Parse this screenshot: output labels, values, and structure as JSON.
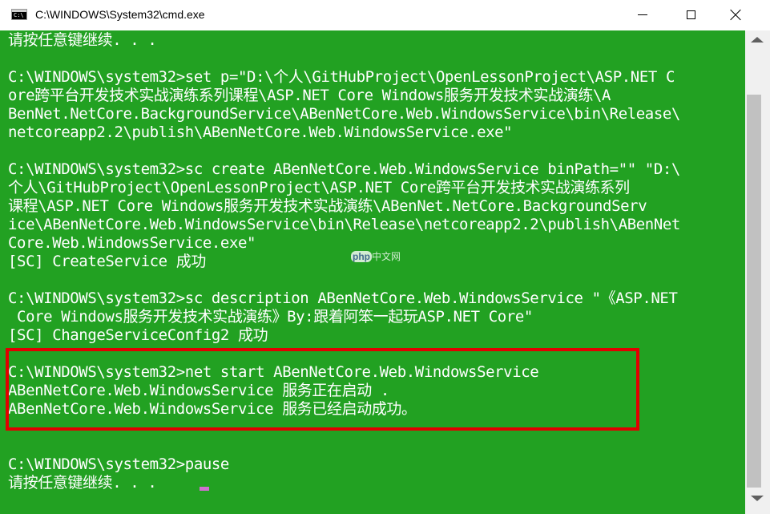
{
  "window": {
    "icon_text": "C:\\",
    "title": "C:\\WINDOWS\\System32\\cmd.exe"
  },
  "console": {
    "lines": [
      "请按任意键继续. . .",
      "",
      "C:\\WINDOWS\\system32>set p=\"D:\\个人\\GitHubProject\\OpenLessonProject\\ASP.NET C",
      "ore跨平台开发技术实战演练系列课程\\ASP.NET Core Windows服务开发技术实战演练\\A",
      "BenNet.NetCore.BackgroundService\\ABenNetCore.Web.WindowsService\\bin\\Release\\",
      "netcoreapp2.2\\publish\\ABenNetCore.Web.WindowsService.exe\"",
      "",
      "C:\\WINDOWS\\system32>sc create ABenNetCore.Web.WindowsService binPath=\"\" \"D:\\",
      "个人\\GitHubProject\\OpenLessonProject\\ASP.NET Core跨平台开发技术实战演练系列",
      "课程\\ASP.NET Core Windows服务开发技术实战演练\\ABenNet.NetCore.BackgroundServ",
      "ice\\ABenNetCore.Web.WindowsService\\bin\\Release\\netcoreapp2.2\\publish\\ABenNet",
      "Core.Web.WindowsService.exe\"",
      "[SC] CreateService 成功",
      "",
      "C:\\WINDOWS\\system32>sc description ABenNetCore.Web.WindowsService \"《ASP.NET",
      " Core Windows服务开发技术实战演练》By:跟着阿笨一起玩ASP.NET Core\"",
      "[SC] ChangeServiceConfig2 成功",
      "",
      "C:\\WINDOWS\\system32>net start ABenNetCore.Web.WindowsService",
      "ABenNetCore.Web.WindowsService 服务正在启动 .",
      "ABenNetCore.Web.WindowsService 服务已经启动成功。",
      "",
      "",
      "C:\\WINDOWS\\system32>pause",
      "请按任意键继续. . ."
    ]
  },
  "watermark": {
    "brand": "php",
    "text": "中文网"
  },
  "colors": {
    "console_background": "#22a122",
    "console_text": "#ffffff",
    "highlight_border": "#e10000",
    "cursor": "#d070d0"
  },
  "icons": {
    "app": "cmd-icon",
    "minimize": "minimize-icon",
    "maximize": "maximize-icon",
    "close": "close-icon",
    "scroll_up": "scroll-up-arrow-icon",
    "scroll_down": "scroll-down-arrow-icon"
  }
}
